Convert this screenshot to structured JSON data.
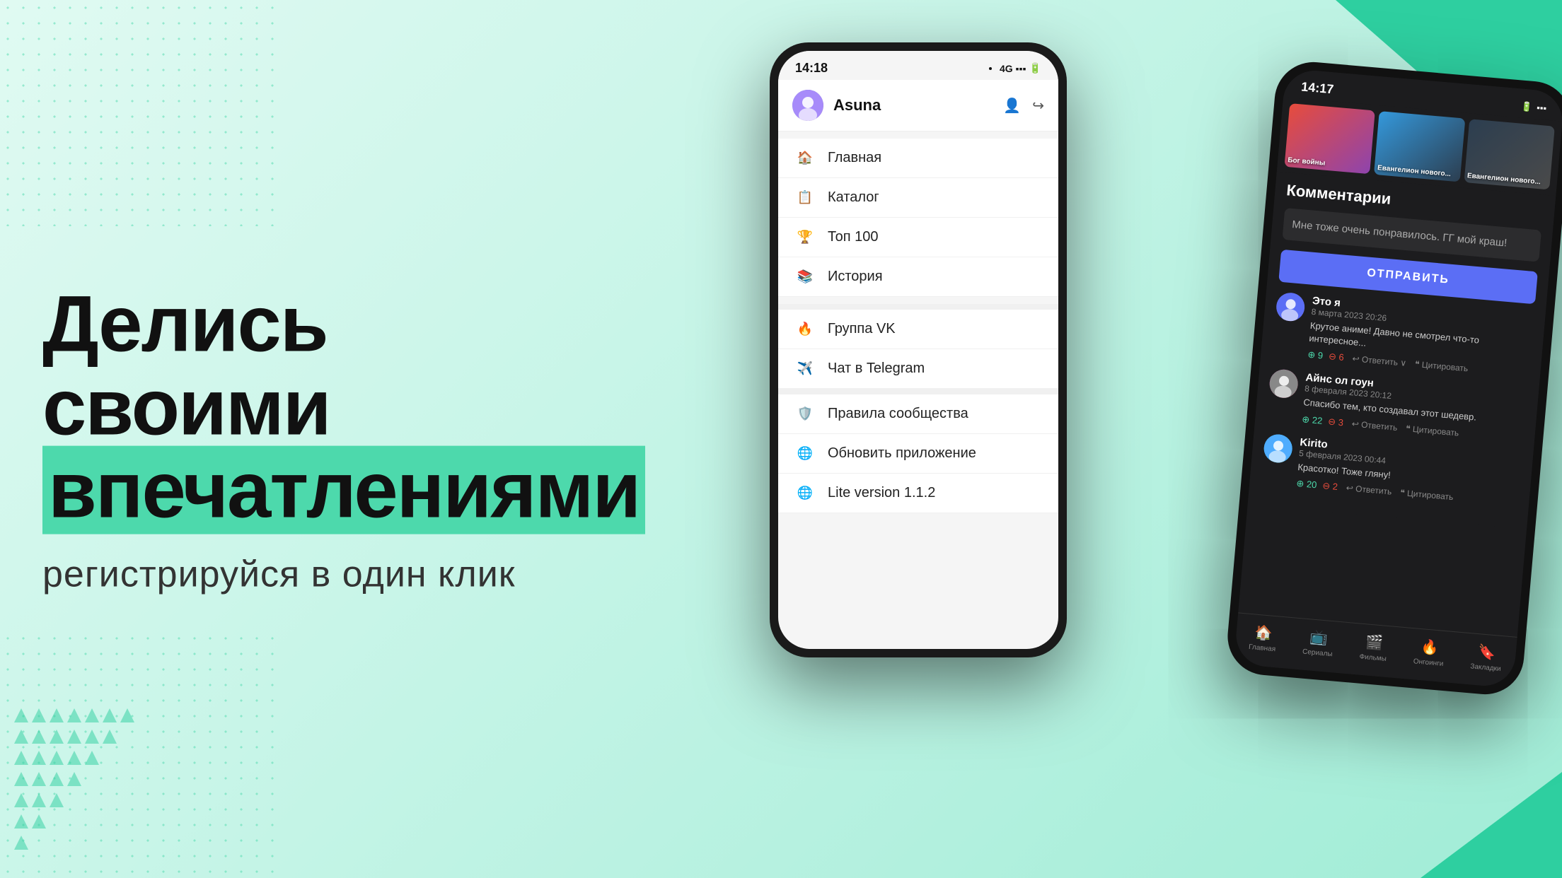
{
  "background": {
    "color": "#e0faf2"
  },
  "left_content": {
    "main_title_line1": "Делись своими",
    "main_title_line2": "впечатлениями",
    "subtitle": "регистрируйся в один клик"
  },
  "phone1": {
    "status_bar": {
      "time": "14:18",
      "icons": "4G ▪▪▪ 🔋"
    },
    "header": {
      "username": "Asuna"
    },
    "menu_items": [
      {
        "icon": "🏠",
        "label": "Главная"
      },
      {
        "icon": "📋",
        "label": "Каталог"
      },
      {
        "icon": "🏆",
        "label": "Топ 100"
      },
      {
        "icon": "📚",
        "label": "История"
      }
    ],
    "social_items": [
      {
        "icon": "🔥",
        "label": "Группа VK"
      },
      {
        "icon": "✈️",
        "label": "Чат в Telegram"
      }
    ],
    "settings_items": [
      {
        "icon": "🛡️",
        "label": "Правила сообщества"
      },
      {
        "icon": "🌐",
        "label": "Обновить приложение"
      },
      {
        "icon": "🌐",
        "label": "Lite version 1.1.2"
      }
    ]
  },
  "phone2": {
    "status_bar": {
      "time": "14:17"
    },
    "thumbnails": [
      {
        "label": "Бог войны"
      },
      {
        "label": "Евангелион нового..."
      },
      {
        "label": "Евангелион нового..."
      }
    ],
    "comments_title": "Комментарии",
    "comment_input": "Мне тоже очень понравилось. ГГ мой краш!",
    "send_button_label": "ОТПРАВИТЬ",
    "comments": [
      {
        "name": "Это я",
        "date": "8 марта 2023 20:26",
        "text": "Крутое аниме! Давно не смотрел что-то интересное...",
        "votes_up": 9,
        "votes_down": 6,
        "actions": [
          "Ответить",
          "Цитировать"
        ]
      },
      {
        "name": "Айнс ол гоун",
        "date": "8 февраля 2023 20:12",
        "text": "Спасибо тем, кто создавал этот шедевр.",
        "votes_up": 22,
        "votes_down": 3,
        "actions": [
          "Ответить",
          "Цитировать"
        ]
      },
      {
        "name": "Kirito",
        "date": "5 февраля 2023 00:44",
        "text": "Красотко! Тоже гляну!",
        "votes_up": 20,
        "votes_down": 2,
        "actions": [
          "Ответить",
          "Цитировать"
        ]
      }
    ],
    "bottom_nav": [
      {
        "icon": "🏠",
        "label": "Главная"
      },
      {
        "icon": "📺",
        "label": "Сериалы"
      },
      {
        "icon": "🎬",
        "label": "Фильмы"
      },
      {
        "icon": "🔥",
        "label": "Онгоинги"
      },
      {
        "icon": "🔖",
        "label": "Закладки"
      }
    ]
  }
}
